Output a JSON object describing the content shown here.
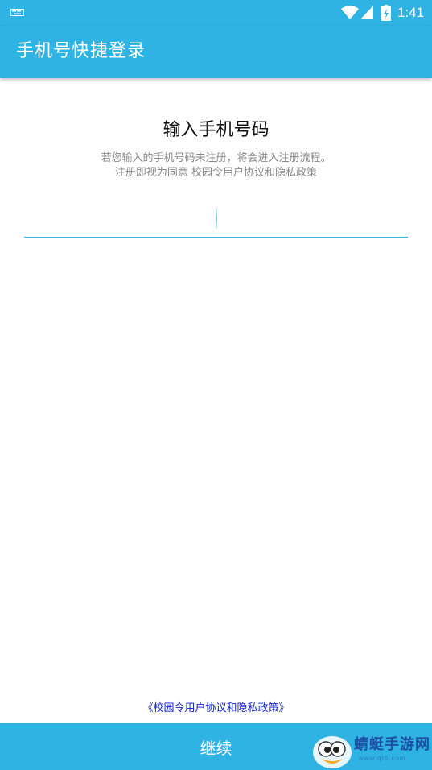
{
  "status_bar": {
    "time": "1:41",
    "icons": [
      "keyboard-icon",
      "wifi-icon",
      "signal-icon",
      "battery-charging-icon"
    ]
  },
  "app_bar": {
    "title": "手机号快捷登录"
  },
  "main": {
    "heading": "输入手机号码",
    "subtitle_line1": "若您输入的手机号码未注册，将会进入注册流程。",
    "subtitle_line2": "注册即视为同意 校园令用户协议和隐私政策",
    "phone_input": {
      "value": "",
      "placeholder": ""
    }
  },
  "footer": {
    "agreement_link": "《校园令用户协议和隐私政策》",
    "continue_label": "继续"
  },
  "watermark": {
    "text": "蜻蜓手游网",
    "sub": "www.qt6.com"
  },
  "colors": {
    "primary": "#2fb3e3",
    "link": "#1122cc",
    "subtitle": "#888888"
  }
}
